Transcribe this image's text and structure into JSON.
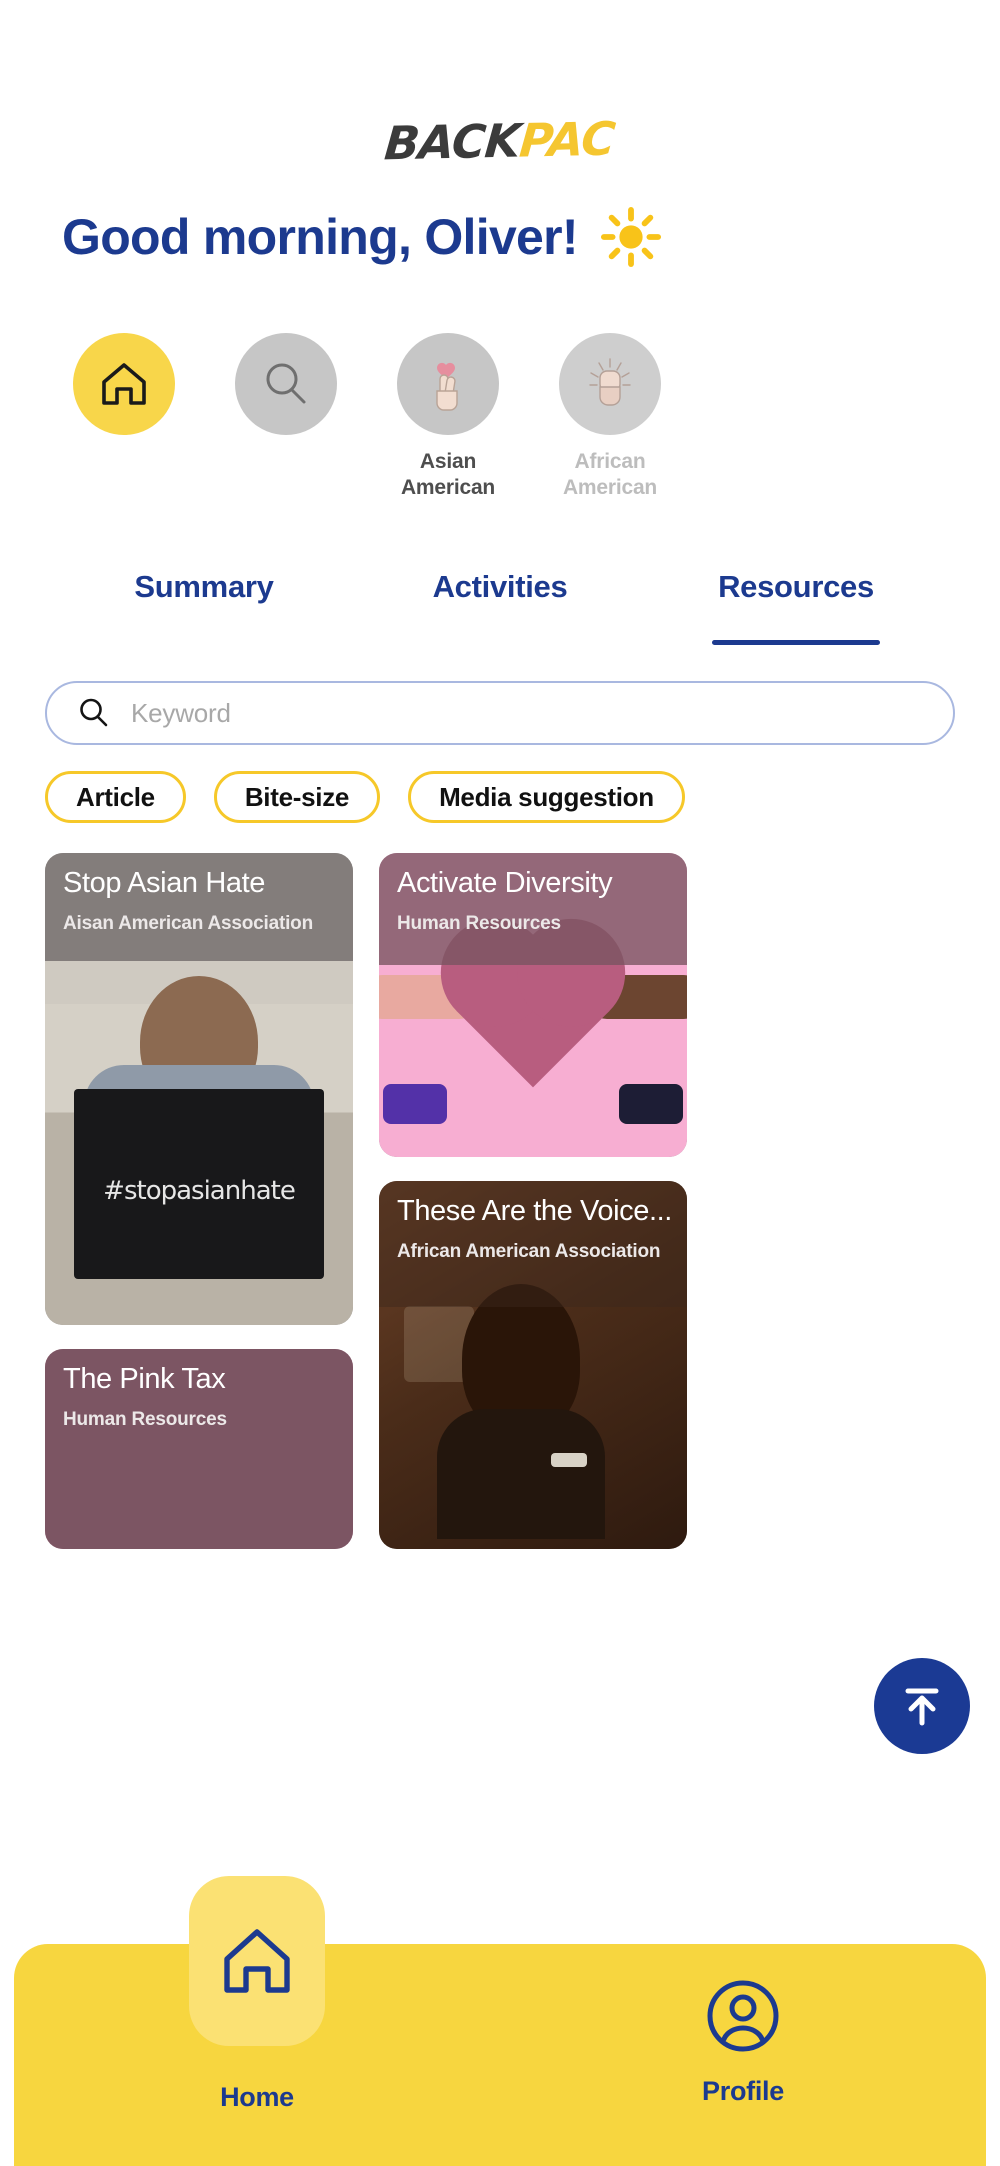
{
  "brand": {
    "logo_first": "BACK",
    "logo_second": "PAC",
    "color_dark": "#3b3b3b",
    "color_yellow": "#f5c630",
    "color_navy": "#1c3a8f"
  },
  "header": {
    "greeting": "Good morning, Oliver!",
    "weather_icon": "sun-icon"
  },
  "categories": [
    {
      "icon": "home-icon",
      "label": "",
      "active": true,
      "faded": false
    },
    {
      "icon": "search-icon",
      "label": "",
      "active": false,
      "faded": false
    },
    {
      "icon": "crossed-fingers-heart-icon",
      "label": "Asian American",
      "active": false,
      "faded": false
    },
    {
      "icon": "raised-fist-icon",
      "label": "African American",
      "active": false,
      "faded": true
    }
  ],
  "tabs": [
    {
      "label": "Summary",
      "active": false
    },
    {
      "label": "Activities",
      "active": false
    },
    {
      "label": "Resources",
      "active": true
    }
  ],
  "search": {
    "placeholder": "Keyword",
    "value": "",
    "icon": "search-icon"
  },
  "filters": [
    {
      "label": "Article"
    },
    {
      "label": "Bite-size"
    },
    {
      "label": "Media suggestion"
    }
  ],
  "cards": {
    "left": [
      {
        "title": "Stop Asian Hate",
        "source": "Aisan American Association",
        "art": "stopasianhate",
        "overlay": "scrim"
      },
      {
        "title": "The Pink Tax",
        "source": "Human Resources",
        "art": "pinktax",
        "overlay": "mauve-full"
      }
    ],
    "right": [
      {
        "title": "Activate Diversity",
        "source": "Human Resources",
        "art": "activate",
        "overlay": "mauve"
      },
      {
        "title": "These Are the Voice...",
        "source": "African American Association",
        "art": "voices",
        "overlay": "scrim"
      }
    ]
  },
  "fab": {
    "name": "scroll-to-top-button",
    "icon": "arrow-up-to-line-icon",
    "color": "#1b3a94"
  },
  "bottom_nav": [
    {
      "label": "Home",
      "icon": "home-icon",
      "active": true
    },
    {
      "label": "Profile",
      "icon": "user-circle-icon",
      "active": false
    }
  ]
}
